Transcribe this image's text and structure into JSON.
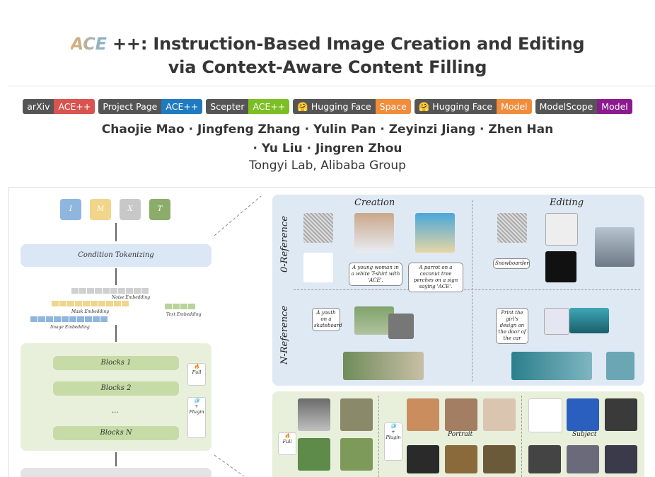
{
  "header": {
    "logo_text": "ACE",
    "title_line1": "++: Instruction-Based Image Creation and Editing",
    "title_line2": "via Context-Aware Content Filling"
  },
  "badges": [
    {
      "left": "arXiv",
      "right": "ACE++",
      "color": "#d9534f"
    },
    {
      "left": "Project Page",
      "right": "ACE++",
      "color": "#1f7ac0"
    },
    {
      "left": "Scepter",
      "right": "ACE++",
      "color": "#7cbf25"
    },
    {
      "left": "🤗 Hugging Face",
      "right": "Space",
      "color": "#f08c3a"
    },
    {
      "left": "🤗 Hugging Face",
      "right": "Model",
      "color": "#f08c3a"
    },
    {
      "left": "ModelScope",
      "right": "Model",
      "color": "#8b1a8f"
    }
  ],
  "authors": {
    "line1": "Chaojie Mao · Jingfeng Zhang · Yulin Pan · Zeyinzi Jiang · Zhen Han",
    "line2": "· Yu Liu · Jingren Zhou",
    "affiliation": "Tongyi Lab, Alibaba Group"
  },
  "figure": {
    "tokens": [
      "I",
      "M",
      "X",
      "T"
    ],
    "token_colors": [
      "#8fb6de",
      "#f0d58a",
      "#c8c8c8",
      "#8cad6a"
    ],
    "condition_tokenizing": "Condition Tokenizing",
    "noise_embedding": "Noise Embedding",
    "mask_embedding": "Mask Embedding",
    "image_embedding": "Image Embedding",
    "text_embedding": "Text Embedding",
    "blocks": [
      "Blocks 1",
      "Blocks 2",
      "...",
      "Blocks N"
    ],
    "full_label": "Full",
    "plugin_label": "Plugin",
    "creation": "Creation",
    "editing": "Editing",
    "zero_ref": "0-Reference",
    "n_ref": "N-Reference",
    "cap_woman": "A young woman in a white T-shirt with 'ACE'.",
    "cap_parrot": "A parrot on a coconut tree perches on a sign saying 'ACE'.",
    "cap_snowboarder": "Snowboarder",
    "cap_skateboard": "A youth on a skateboard",
    "cap_print": "Print the girl's design on the door of the car",
    "portrait": "Portrait",
    "subject": "Subject"
  }
}
